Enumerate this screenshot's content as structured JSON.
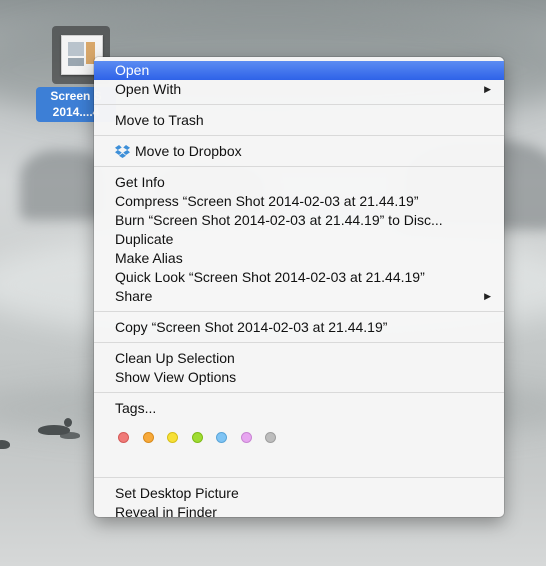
{
  "desktop_icon": {
    "label_line1": "Screen S",
    "label_line2": "2014....4"
  },
  "menu": {
    "open": "Open",
    "open_with": "Open With",
    "move_to_trash": "Move to Trash",
    "move_to_dropbox": "Move to Dropbox",
    "get_info": "Get Info",
    "compress": "Compress “Screen Shot 2014-02-03 at 21.44.19”",
    "burn": "Burn “Screen Shot 2014-02-03 at 21.44.19” to Disc...",
    "duplicate": "Duplicate",
    "make_alias": "Make Alias",
    "quick_look": "Quick Look “Screen Shot 2014-02-03 at 21.44.19”",
    "share": "Share",
    "copy": "Copy “Screen Shot 2014-02-03 at 21.44.19”",
    "clean_up_selection": "Clean Up Selection",
    "show_view_options": "Show View Options",
    "tags": "Tags...",
    "set_desktop_picture": "Set Desktop Picture",
    "reveal_in_finder": "Reveal in Finder",
    "submenu_arrow": "▶"
  },
  "tag_colors": [
    {
      "name": "red",
      "color": "#f07a78",
      "border": "#d45a58"
    },
    {
      "name": "orange",
      "color": "#f7a93a",
      "border": "#d98b1c"
    },
    {
      "name": "yellow",
      "color": "#f7e037",
      "border": "#d6bf18"
    },
    {
      "name": "green",
      "color": "#9fdc32",
      "border": "#7fbb17"
    },
    {
      "name": "blue",
      "color": "#7fc4f4",
      "border": "#5aa5d8"
    },
    {
      "name": "purple",
      "color": "#e7a6f0",
      "border": "#c985d3"
    },
    {
      "name": "gray",
      "color": "#bdbdbd",
      "border": "#9e9e9e"
    }
  ],
  "colors": {
    "highlight": "#2e62e8",
    "selection_label": "#3d7fd6"
  },
  "icons": {
    "dropbox": "dropbox-icon"
  }
}
